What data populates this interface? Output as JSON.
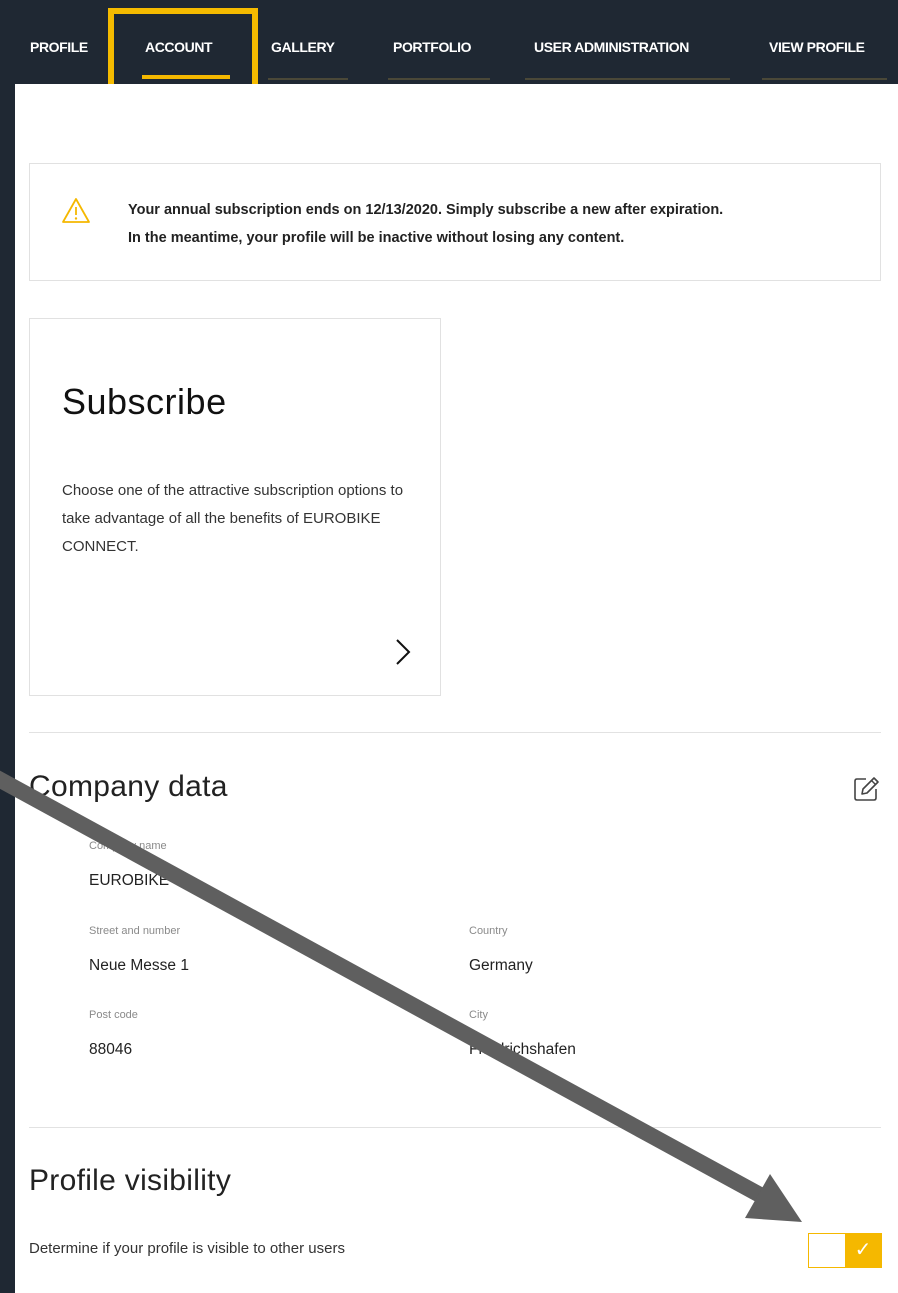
{
  "nav": {
    "tabs": [
      {
        "label": "PROFILE"
      },
      {
        "label": "ACCOUNT"
      },
      {
        "label": "GALLERY"
      },
      {
        "label": "PORTFOLIO"
      },
      {
        "label": "USER ADMINISTRATION"
      },
      {
        "label": "VIEW PROFILE"
      }
    ],
    "active_tab": "ACCOUNT"
  },
  "notice": {
    "icon": "warning-icon",
    "line1": "Your annual subscription ends on 12/13/2020. Simply subscribe a new after expiration.",
    "line2": "In the meantime, your profile will be inactive without losing any content."
  },
  "subscribe": {
    "title": "Subscribe",
    "description": "Choose one of the attractive subscription options to take advantage of all the benefits of EUROBIKE CONNECT.",
    "icon": "chevron-right-icon"
  },
  "company": {
    "title": "Company data",
    "edit_icon": "edit-pencil-icon",
    "fields": {
      "company_name": {
        "label": "Company name",
        "value": "EUROBIKE"
      },
      "street": {
        "label": "Street and number",
        "value": "Neue Messe 1"
      },
      "country": {
        "label": "Country",
        "value": "Germany"
      },
      "postcode": {
        "label": "Post code",
        "value": "88046"
      },
      "city": {
        "label": "City",
        "value": "Friedrichshafen"
      }
    }
  },
  "visibility": {
    "title": "Profile visibility",
    "description": "Determine if your profile is visible to other users",
    "toggle_on": true,
    "toggle_glyph": "✓"
  },
  "colors": {
    "accent": "#f5b800",
    "nav_background": "#1f2833",
    "annotation_arrow": "#5f5f5f"
  }
}
